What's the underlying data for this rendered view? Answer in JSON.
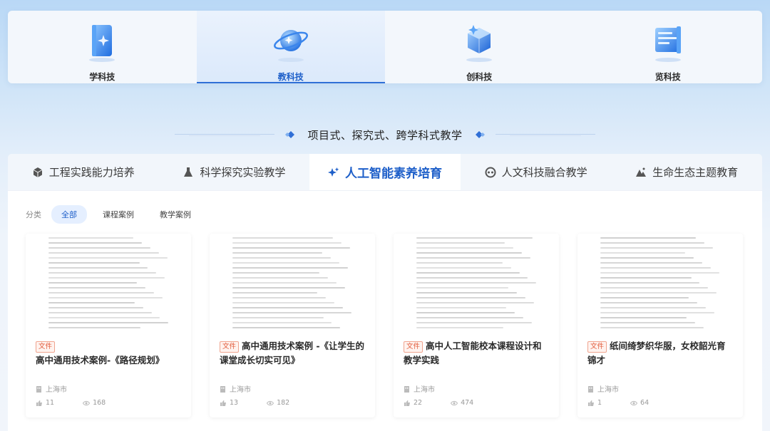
{
  "top_nav": {
    "items": [
      {
        "label": "学科技",
        "icon": "book-icon",
        "active": false
      },
      {
        "label": "教科技",
        "icon": "planet-icon",
        "active": true
      },
      {
        "label": "创科技",
        "icon": "cube-icon",
        "active": false
      },
      {
        "label": "览科技",
        "icon": "screen-icon",
        "active": false
      }
    ]
  },
  "section": {
    "title": "项目式、探究式、跨学科式教学"
  },
  "tabs": [
    {
      "label": "工程实践能力培养",
      "icon": "cube-outline-icon"
    },
    {
      "label": "科学探究实验教学",
      "icon": "flask-icon"
    },
    {
      "label": "人工智能素养培育",
      "icon": "sparkle-icon"
    },
    {
      "label": "人文科技融合教学",
      "icon": "gear-people-icon"
    },
    {
      "label": "生命生态主题教育",
      "icon": "mountain-icon"
    }
  ],
  "filters": {
    "label": "分类",
    "options": [
      "全部",
      "课程案例",
      "教学案例"
    ]
  },
  "cards": [
    {
      "badge": "文件",
      "title": "高中通用技术案例-《路径规划》",
      "location": "上海市",
      "likes": "11",
      "views": "168"
    },
    {
      "badge": "文件",
      "title": "高中通用技术案例 -《让学生的课堂成长切实可见》",
      "location": "上海市",
      "likes": "13",
      "views": "182"
    },
    {
      "badge": "文件",
      "title": "高中人工智能校本课程设计和教学实践",
      "location": "上海市",
      "likes": "22",
      "views": "474"
    },
    {
      "badge": "文件",
      "title": "纸间绮梦织华服，女校韶光育锦才",
      "location": "上海市",
      "likes": "1",
      "views": "64"
    }
  ],
  "colors": {
    "accent": "#1e5fc9",
    "badge": "#e15a3a"
  }
}
